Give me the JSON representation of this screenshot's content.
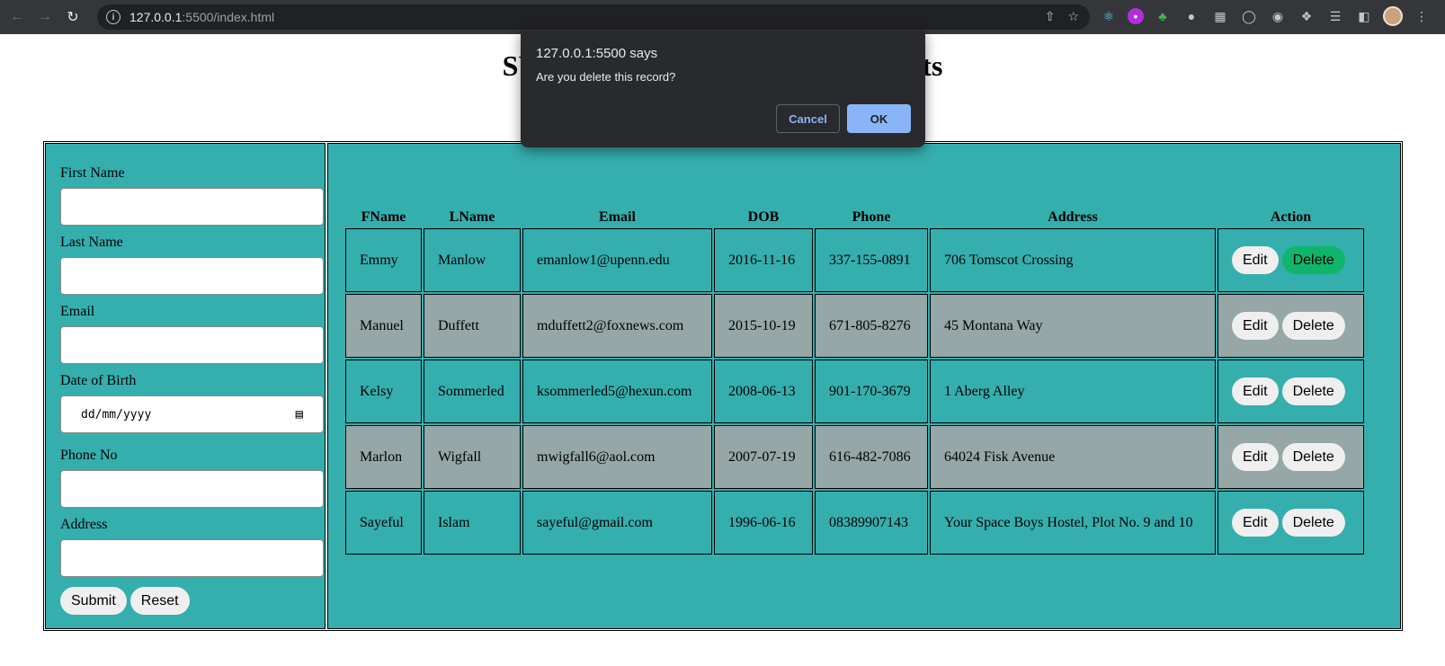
{
  "browser": {
    "url_host": "127.0.0.1",
    "url_rest": ":5500/index.html"
  },
  "page": {
    "title_visible_start": "SU",
    "title_visible_end": "nts"
  },
  "form": {
    "first_name_label": "First Name",
    "last_name_label": "Last Name",
    "email_label": "Email",
    "dob_label": "Date of Birth",
    "dob_placeholder": "dd/mm/yyyy",
    "phone_label": "Phone No",
    "address_label": "Address",
    "submit_label": "Submit",
    "reset_label": "Reset"
  },
  "table": {
    "headers": [
      "FName",
      "LName",
      "Email",
      "DOB",
      "Phone",
      "Address",
      "Action"
    ],
    "edit_label": "Edit",
    "delete_label": "Delete",
    "rows": [
      {
        "fname": "Emmy",
        "lname": "Manlow",
        "email": "emanlow1@upenn.edu",
        "dob": "2016-11-16",
        "phone": "337-155-0891",
        "address": "706 Tomscot Crossing"
      },
      {
        "fname": "Manuel",
        "lname": "Duffett",
        "email": "mduffett2@foxnews.com",
        "dob": "2015-10-19",
        "phone": "671-805-8276",
        "address": "45 Montana Way"
      },
      {
        "fname": "Kelsy",
        "lname": "Sommerled",
        "email": "ksommerled5@hexun.com",
        "dob": "2008-06-13",
        "phone": "901-170-3679",
        "address": "1 Aberg Alley"
      },
      {
        "fname": "Marlon",
        "lname": "Wigfall",
        "email": "mwigfall6@aol.com",
        "dob": "2007-07-19",
        "phone": "616-482-7086",
        "address": "64024 Fisk Avenue"
      },
      {
        "fname": "Sayeful",
        "lname": "Islam",
        "email": "sayeful@gmail.com",
        "dob": "1996-06-16",
        "phone": "08389907143",
        "address": "Your Space Boys Hostel, Plot No. 9 and 10"
      }
    ]
  },
  "dialog": {
    "title": "127.0.0.1:5500 says",
    "message": "Are you delete this record?",
    "cancel_label": "Cancel",
    "ok_label": "OK"
  },
  "colors": {
    "panel_teal": "#35aeae",
    "alt_row_gray": "#95a7a7",
    "delete_hover_green": "#0fb56a",
    "dialog_bg": "#292a2d",
    "dialog_ok_blue": "#8ab4f8"
  }
}
